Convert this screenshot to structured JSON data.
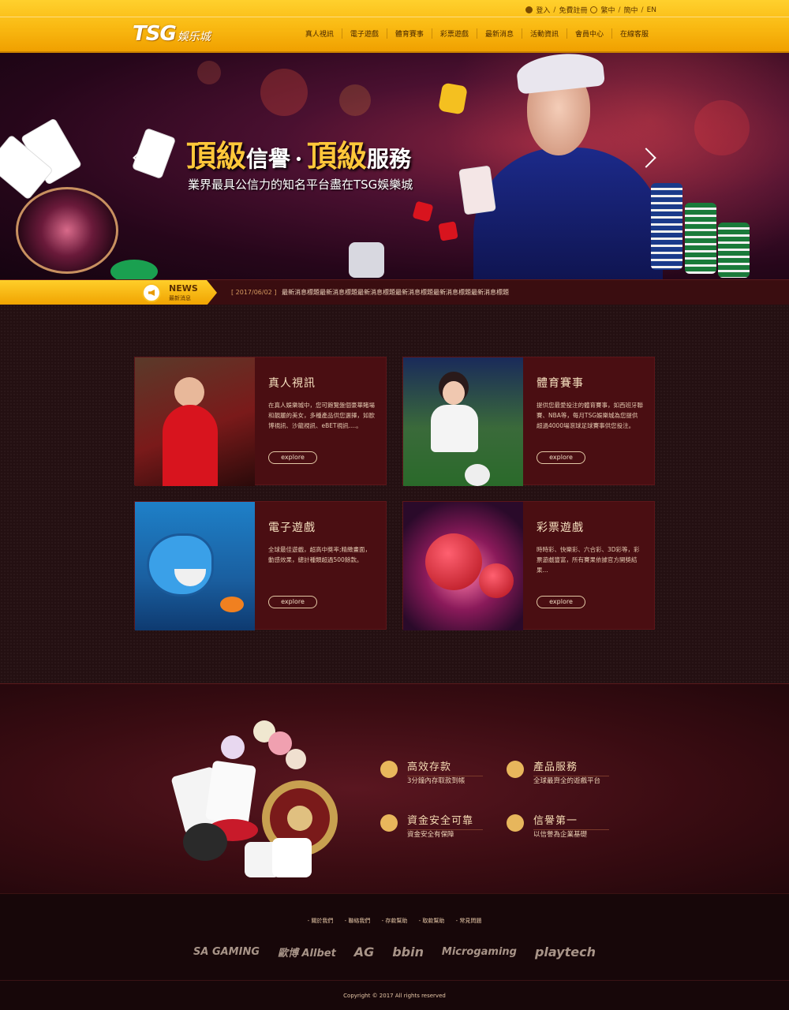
{
  "header": {
    "logo_text": "TSG",
    "logo_cn": "娛乐城",
    "top_links": {
      "login": "登入",
      "register": "免費註冊",
      "lang_tc": "繁中",
      "lang_sc": "簡中",
      "lang_en": "EN",
      "sep": "/"
    },
    "nav": [
      "真人視訊",
      "電子遊戲",
      "體育賽事",
      "彩票遊戲",
      "最新消息",
      "活動資訊",
      "會員中心",
      "在線客服"
    ]
  },
  "hero": {
    "headline_part1_big": "頂級",
    "headline_part1_small": "信譽",
    "headline_dot": "·",
    "headline_part2_big": "頂級",
    "headline_part2_small": "服務",
    "subline": "業界最具公信力的知名平台盡在TSG娛樂城"
  },
  "news": {
    "label_en": "NEWS",
    "label_cn": "最新消息",
    "date": "[ 2017/06/02 ]",
    "text": "最新消息標題最新消息標題最新消息標題最新消息標題最新消息標題最新消息標題"
  },
  "cards": [
    {
      "title": "真人視訊",
      "desc": "在真人娛樂城中，您可飽覽盤個豪華賭場和靚麗的美女，多種產品供您選擇，如歐博視訊、沙龍視訊、eBET視訊....。",
      "button": "explore"
    },
    {
      "title": "體育賽事",
      "desc": "提供您最愛投注的體育賽事，如西班牙聯賽、NBA等，每月TSG娛樂城為您提供超過4000場滾球足球賽事供您投注。",
      "button": "explore"
    },
    {
      "title": "電子遊戲",
      "desc": "全球最佳遊戲，超高中獎率;精緻畫面，動感效果，總計種類超過500餘款。",
      "button": "explore"
    },
    {
      "title": "彩票遊戲",
      "desc": "時時彩、快樂彩、六合彩、3D彩等，彩票遊戲豐富，所有賽果依據官方開獎結果...",
      "button": "explore"
    }
  ],
  "features": [
    {
      "title": "高效存款",
      "desc": "3分鐘內存取款到帳",
      "icon": "wallet-icon"
    },
    {
      "title": "產品服務",
      "desc": "全球最齊全的遊戲平台",
      "icon": "globe-icon"
    },
    {
      "title": "資金安全可靠",
      "desc": "資金安全有保障",
      "icon": "shield-icon"
    },
    {
      "title": "信譽第一",
      "desc": "以信譽為企業基礎",
      "icon": "thumbs-up-icon"
    }
  ],
  "footer": {
    "links": [
      "- 關於我們",
      "- 聯絡我們",
      "- 存款幫助",
      "- 取款幫助",
      "- 常見問題"
    ],
    "partners": [
      "SA GAMING",
      "歐博 Allbet",
      "AG",
      "bbin",
      "Microgaming",
      "playtech"
    ],
    "copyright": "Copyright © 2017 All rights reserved"
  },
  "colors": {
    "accent_gold": "#f9b811",
    "dark_maroon": "#4a0e12",
    "page_bg": "#241012"
  }
}
